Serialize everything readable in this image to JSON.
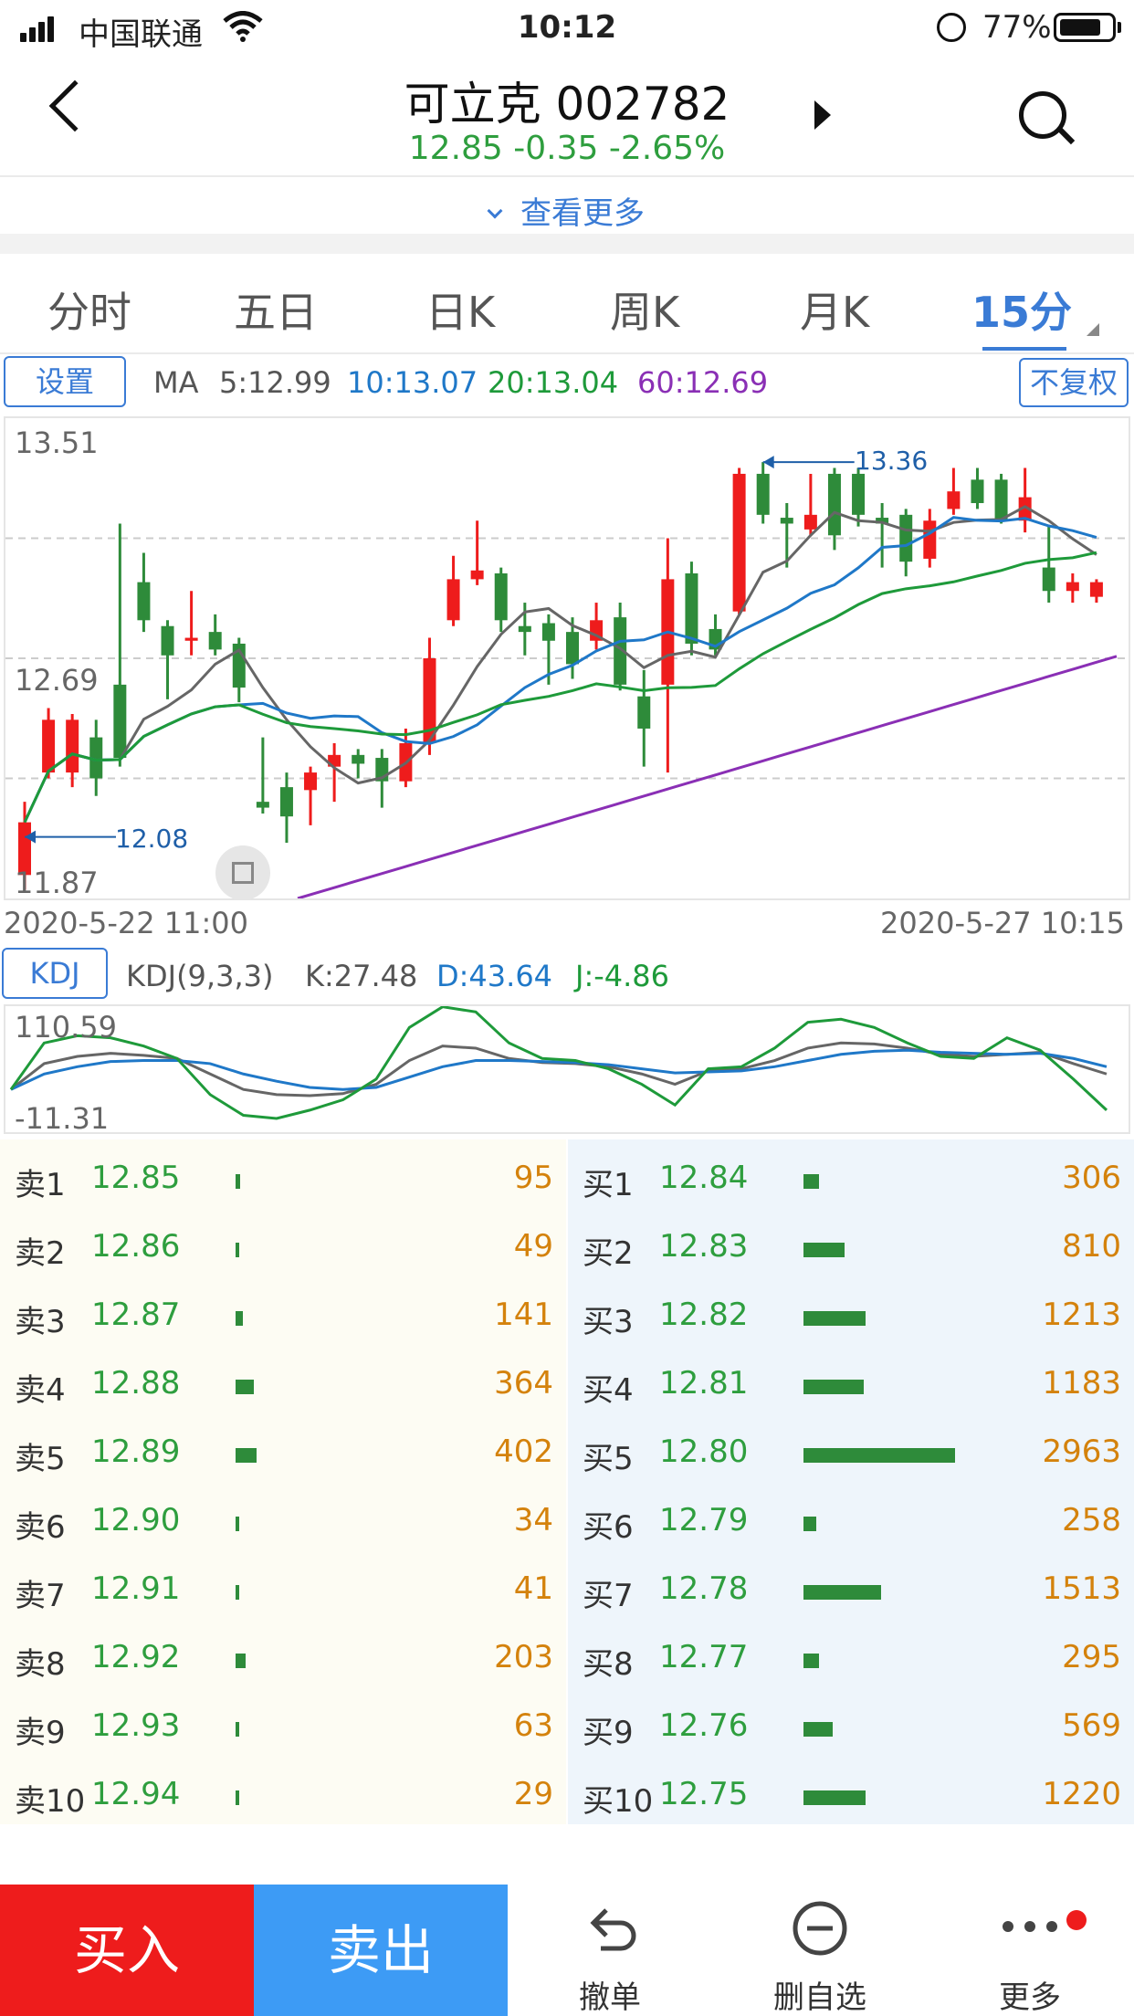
{
  "status_bar": {
    "carrier": "中国联通",
    "time": "10:12",
    "battery": "77%"
  },
  "header": {
    "title": "可立克 002782",
    "quote": "12.85 -0.35 -2.65%",
    "more": "查看更多"
  },
  "tabs": [
    "分时",
    "五日",
    "日K",
    "周K",
    "月K",
    "15分"
  ],
  "active_tab": 5,
  "settings_label": "设置",
  "ma": {
    "label": "MA",
    "ma5": "5:12.99",
    "ma10": "10:13.07",
    "ma20": "20:13.04",
    "ma60": "60:12.69"
  },
  "adjust_label": "不复权",
  "kline": {
    "y_top": "13.51",
    "y_mid": "12.69",
    "y_bottom": "11.87",
    "high_marker": "13.36",
    "low_marker": "12.08",
    "start_time": "2020-5-22 11:00",
    "end_time": "2020-5-27 10:15"
  },
  "kdj": {
    "button": "KDJ",
    "params": "KDJ(9,3,3)",
    "k": "K:27.48",
    "d": "D:43.64",
    "j": "J:-4.86",
    "y_top": "110.59",
    "y_bottom": "-11.31"
  },
  "order_book": {
    "asks": [
      {
        "label": "卖1",
        "price": "12.85",
        "volume": "95"
      },
      {
        "label": "卖2",
        "price": "12.86",
        "volume": "49"
      },
      {
        "label": "卖3",
        "price": "12.87",
        "volume": "141"
      },
      {
        "label": "卖4",
        "price": "12.88",
        "volume": "364"
      },
      {
        "label": "卖5",
        "price": "12.89",
        "volume": "402"
      },
      {
        "label": "卖6",
        "price": "12.90",
        "volume": "34"
      },
      {
        "label": "卖7",
        "price": "12.91",
        "volume": "41"
      },
      {
        "label": "卖8",
        "price": "12.92",
        "volume": "203"
      },
      {
        "label": "卖9",
        "price": "12.93",
        "volume": "63"
      },
      {
        "label": "卖10",
        "price": "12.94",
        "volume": "29"
      }
    ],
    "bids": [
      {
        "label": "买1",
        "price": "12.84",
        "volume": "306"
      },
      {
        "label": "买2",
        "price": "12.83",
        "volume": "810"
      },
      {
        "label": "买3",
        "price": "12.82",
        "volume": "1213"
      },
      {
        "label": "买4",
        "price": "12.81",
        "volume": "1183"
      },
      {
        "label": "买5",
        "price": "12.80",
        "volume": "2963"
      },
      {
        "label": "买6",
        "price": "12.79",
        "volume": "258"
      },
      {
        "label": "买7",
        "price": "12.78",
        "volume": "1513"
      },
      {
        "label": "买8",
        "price": "12.77",
        "volume": "295"
      },
      {
        "label": "买9",
        "price": "12.76",
        "volume": "569"
      },
      {
        "label": "买10",
        "price": "12.75",
        "volume": "1220"
      }
    ]
  },
  "bottom_bar": {
    "buy": "买入",
    "sell": "卖出",
    "cancel": "撤单",
    "remove": "删自选",
    "more": "更多"
  },
  "colors": {
    "up": "#ee1c1c",
    "down": "#2e8b3a",
    "accent": "#3a7bd5",
    "ma5": "#666666",
    "ma10": "#1f78c8",
    "ma20": "#1e9a3a",
    "ma60": "#8a2fb5"
  }
}
